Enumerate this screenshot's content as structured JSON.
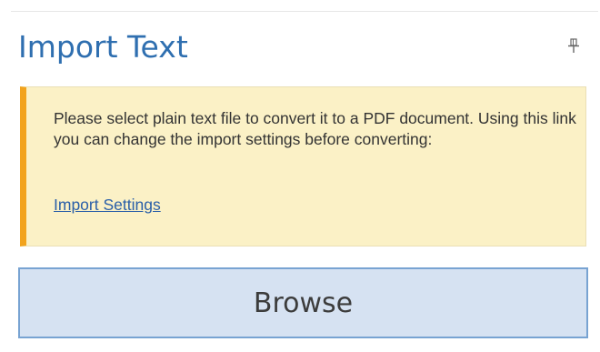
{
  "panel": {
    "title": "Import Text",
    "pin_icon": "pin-icon"
  },
  "info": {
    "message": "Please select plain text file to convert it to a PDF document. Using this link you can change the import settings before converting:",
    "link_label": "Import Settings"
  },
  "actions": {
    "browse_label": "Browse"
  },
  "colors": {
    "title": "#2f6fb0",
    "info_background": "#fbf1c6",
    "info_accent": "#f2a31d",
    "link": "#2a5fa8",
    "button_background": "#d6e2f2",
    "button_border": "#78a3d2"
  }
}
